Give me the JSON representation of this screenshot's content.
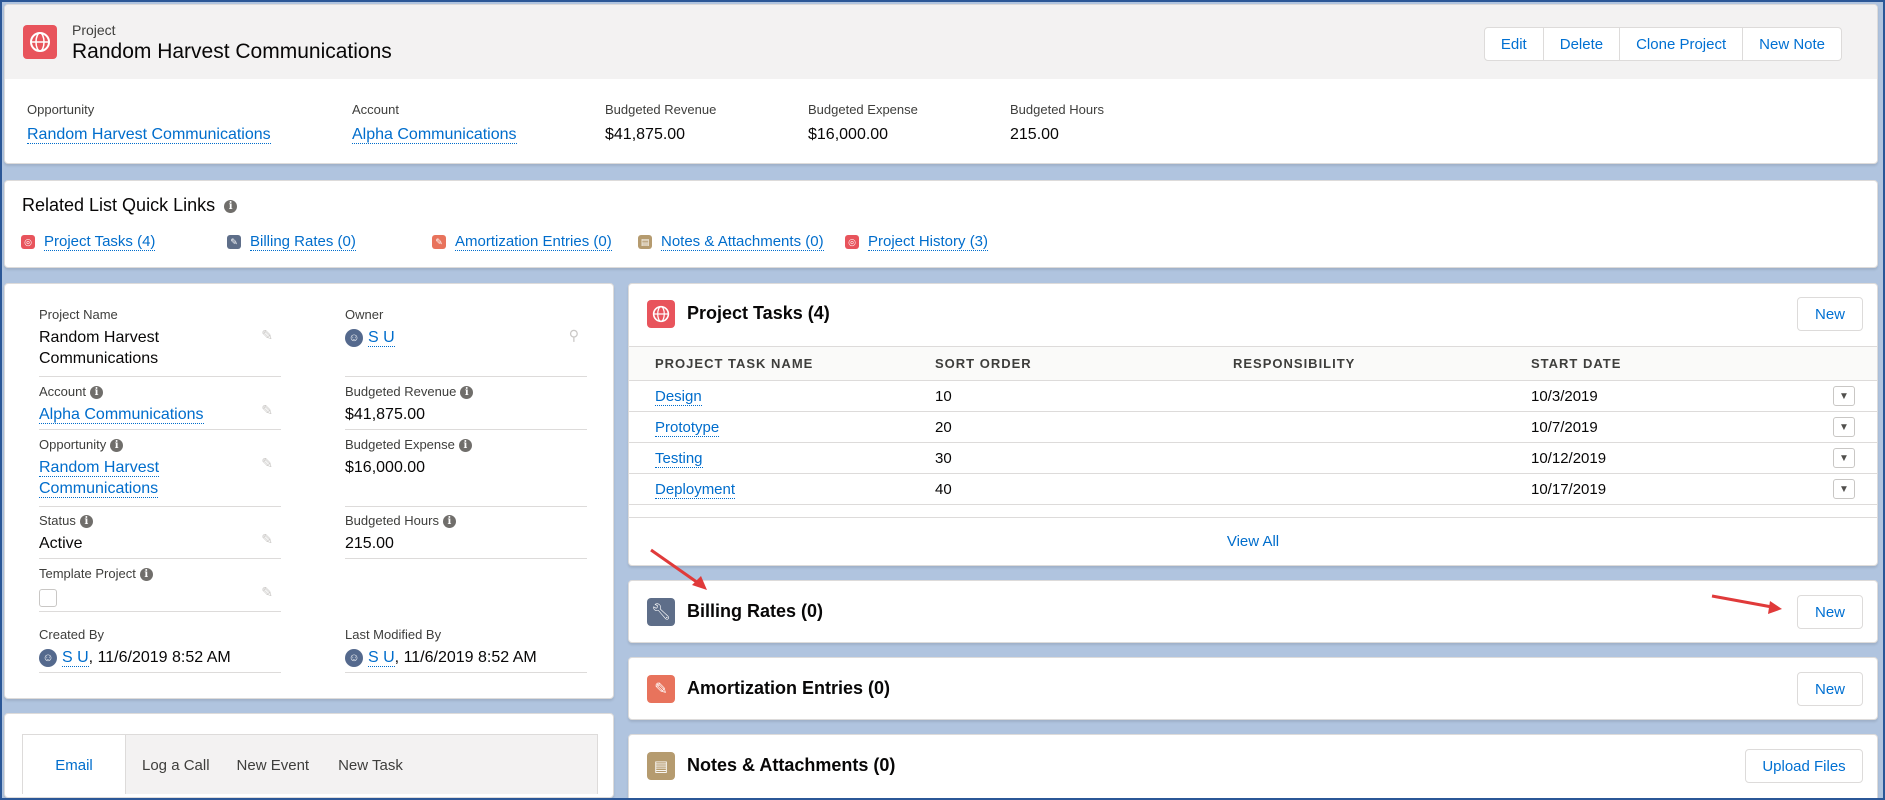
{
  "header": {
    "object_label": "Project",
    "title": "Random Harvest Communications",
    "buttons": [
      "Edit",
      "Delete",
      "Clone Project",
      "New Note"
    ],
    "highlights": [
      {
        "label": "Opportunity",
        "value": "Random Harvest Communications",
        "link": true
      },
      {
        "label": "Account",
        "value": "Alpha Communications",
        "link": true
      },
      {
        "label": "Budgeted Revenue",
        "value": "$41,875.00",
        "link": false
      },
      {
        "label": "Budgeted Expense",
        "value": "$16,000.00",
        "link": false
      },
      {
        "label": "Budgeted Hours",
        "value": "215.00",
        "link": false
      }
    ]
  },
  "quick_links": {
    "title": "Related List Quick Links",
    "items": [
      {
        "label": "Project Tasks (4)",
        "color": "#e8545c"
      },
      {
        "label": "Billing Rates (0)",
        "color": "#5e6e89"
      },
      {
        "label": "Amortization Entries (0)",
        "color": "#e8735c"
      },
      {
        "label": "Notes & Attachments (0)",
        "color": "#b59b6f"
      },
      {
        "label": "Project History (3)",
        "color": "#e8545c"
      }
    ]
  },
  "details": {
    "project_name_label": "Project Name",
    "project_name_line1": "Random Harvest",
    "project_name_line2": "Communications",
    "owner_label": "Owner",
    "owner_value": "S U",
    "account_label": "Account",
    "account_value": "Alpha Communications",
    "budgeted_revenue_label": "Budgeted Revenue",
    "budgeted_revenue_value": "$41,875.00",
    "opportunity_label": "Opportunity",
    "opportunity_line1": "Random Harvest",
    "opportunity_line2": "Communications",
    "budgeted_expense_label": "Budgeted Expense",
    "budgeted_expense_value": "$16,000.00",
    "status_label": "Status",
    "status_value": "Active",
    "budgeted_hours_label": "Budgeted Hours",
    "budgeted_hours_value": "215.00",
    "template_label": "Template Project",
    "created_by_label": "Created By",
    "created_by_user": "S U",
    "created_by_date": ", 11/6/2019 8:52 AM",
    "modified_by_label": "Last Modified By",
    "modified_by_user": "S U",
    "modified_by_date": ", 11/6/2019 8:52 AM"
  },
  "activity": {
    "tabs": [
      "Email",
      "Log a Call",
      "New Event",
      "New Task"
    ]
  },
  "project_tasks": {
    "title": "Project Tasks (4)",
    "new_label": "New",
    "columns": [
      "PROJECT TASK NAME",
      "SORT ORDER",
      "RESPONSIBILITY",
      "START DATE"
    ],
    "rows": [
      {
        "name": "Design",
        "sort": "10",
        "resp": "",
        "date": "10/3/2019"
      },
      {
        "name": "Prototype",
        "sort": "20",
        "resp": "",
        "date": "10/7/2019"
      },
      {
        "name": "Testing",
        "sort": "30",
        "resp": "",
        "date": "10/12/2019"
      },
      {
        "name": "Deployment",
        "sort": "40",
        "resp": "",
        "date": "10/17/2019"
      }
    ],
    "view_all": "View All"
  },
  "billing_rates": {
    "title": "Billing Rates (0)",
    "new_label": "New"
  },
  "amortization": {
    "title": "Amortization Entries (0)",
    "new_label": "New"
  },
  "notes": {
    "title": "Notes & Attachments (0)",
    "upload_label": "Upload Files"
  },
  "colors": {
    "project_icon": "#e8545c",
    "billing_icon": "#5e6e89",
    "amortization_icon": "#e8735c",
    "notes_icon": "#b59b6f",
    "annotation_arrow": "#e03a3a"
  }
}
